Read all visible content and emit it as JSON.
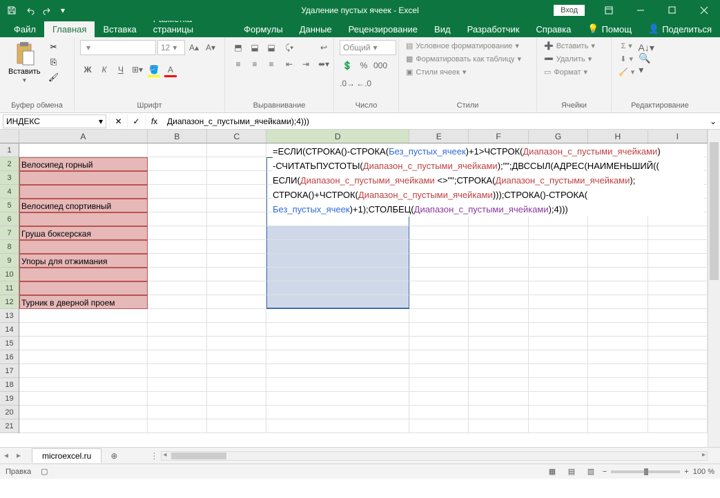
{
  "titlebar": {
    "title": "Удаление пустых ячеек  -  Excel",
    "login": "Вход"
  },
  "tabs": {
    "file": "Файл",
    "home": "Главная",
    "insert": "Вставка",
    "layout": "Разметка страницы",
    "formulas": "Формулы",
    "data": "Данные",
    "review": "Рецензирование",
    "view": "Вид",
    "developer": "Разработчик",
    "help": "Справка",
    "tellme": "Помощ",
    "share": "Поделиться"
  },
  "ribbon": {
    "clipboard": {
      "paste": "Вставить",
      "label": "Буфер обмена"
    },
    "font": {
      "name": "",
      "size": "12",
      "label": "Шрифт",
      "bold": "Ж",
      "italic": "К",
      "underline": "Ч"
    },
    "alignment": {
      "label": "Выравнивание"
    },
    "number": {
      "format": "Общий",
      "label": "Число"
    },
    "styles": {
      "cond": "Условное форматирование",
      "table": "Форматировать как таблицу",
      "cell": "Стили ячеек",
      "label": "Стили"
    },
    "cells": {
      "insert": "Вставить",
      "delete": "Удалить",
      "format": "Формат",
      "label": "Ячейки"
    },
    "editing": {
      "label": "Редактирование"
    }
  },
  "formulaBar": {
    "nameBox": "ИНДЕКС",
    "formulaShort": "Диапазон_с_пустыми_ячейками);4)))"
  },
  "grid": {
    "columns": [
      "A",
      "B",
      "C",
      "D",
      "E",
      "F",
      "G",
      "H",
      "I"
    ],
    "rows": [
      1,
      2,
      3,
      4,
      5,
      6,
      7,
      8,
      9,
      10,
      11,
      12,
      13,
      14,
      15,
      16,
      17,
      18,
      19,
      20,
      21
    ],
    "colA": {
      "2": "Велосипед горный",
      "3": "",
      "4": "",
      "5": "Велосипед спортивный",
      "6": "",
      "7": "Груша боксерская",
      "8": "",
      "9": "Упоры для отжимания",
      "10": "",
      "11": "",
      "12": "Турник в дверной проем"
    },
    "activeCell": "D2",
    "selection": "D2:D12",
    "formulaTokens": [
      [
        {
          "t": "=ЕСЛИ",
          "c": "fn"
        },
        {
          "t": "(",
          "c": "op"
        },
        {
          "t": "СТРОКА",
          "c": "fn"
        },
        {
          "t": "()-",
          "c": "op"
        },
        {
          "t": "СТРОКА",
          "c": "fn"
        },
        {
          "t": "(",
          "c": "op"
        },
        {
          "t": "Без_пустых_ячеек",
          "c": "nm1"
        },
        {
          "t": ")+1>",
          "c": "op"
        },
        {
          "t": "ЧСТРОК",
          "c": "fn"
        },
        {
          "t": "(",
          "c": "op"
        },
        {
          "t": "Диапазон_с_пустыми_ячейками",
          "c": "nm2"
        },
        {
          "t": ")",
          "c": "op"
        }
      ],
      [
        {
          "t": "-",
          "c": "op"
        },
        {
          "t": "СЧИТАТЬПУСТОТЫ",
          "c": "fn"
        },
        {
          "t": "(",
          "c": "op"
        },
        {
          "t": "Диапазон_с_пустыми_ячейками",
          "c": "nm2"
        },
        {
          "t": ");\"\";",
          "c": "op"
        },
        {
          "t": "ДВССЫЛ",
          "c": "fn"
        },
        {
          "t": "(",
          "c": "op"
        },
        {
          "t": "АДРЕС",
          "c": "fn"
        },
        {
          "t": "(",
          "c": "op"
        },
        {
          "t": "НАИМЕНЬШИЙ",
          "c": "fn"
        },
        {
          "t": "((",
          "c": "op"
        }
      ],
      [
        {
          "t": "ЕСЛИ",
          "c": "fn"
        },
        {
          "t": "(",
          "c": "op"
        },
        {
          "t": "Диапазон_с_пустыми_ячейками",
          "c": "nm2"
        },
        {
          "t": " <>\"\";",
          "c": "op"
        },
        {
          "t": "СТРОКА",
          "c": "fn"
        },
        {
          "t": "(",
          "c": "op"
        },
        {
          "t": "Диапазон_с_пустыми_ячейками",
          "c": "nm2"
        },
        {
          "t": ");",
          "c": "op"
        }
      ],
      [
        {
          "t": "СТРОКА",
          "c": "fn"
        },
        {
          "t": "()+",
          "c": "op"
        },
        {
          "t": "ЧСТРОК",
          "c": "fn"
        },
        {
          "t": "(",
          "c": "op"
        },
        {
          "t": "Диапазон_с_пустыми_ячейками",
          "c": "nm2"
        },
        {
          "t": ")));",
          "c": "op"
        },
        {
          "t": "СТРОКА",
          "c": "fn"
        },
        {
          "t": "()-",
          "c": "op"
        },
        {
          "t": "СТРОКА",
          "c": "fn"
        },
        {
          "t": "(",
          "c": "op"
        }
      ],
      [
        {
          "t": "Без_пустых_ячеек",
          "c": "nm1"
        },
        {
          "t": ")+1);",
          "c": "op"
        },
        {
          "t": "СТОЛБЕЦ",
          "c": "fn"
        },
        {
          "t": "(",
          "c": "op"
        },
        {
          "t": "Диапазон_с_пустыми_ячейками",
          "c": "nm3"
        },
        {
          "t": ");4)))",
          "c": "op"
        }
      ]
    ]
  },
  "sheetTabs": {
    "active": "microexcel.ru"
  },
  "statusbar": {
    "mode": "Правка",
    "zoom": "100 %"
  }
}
